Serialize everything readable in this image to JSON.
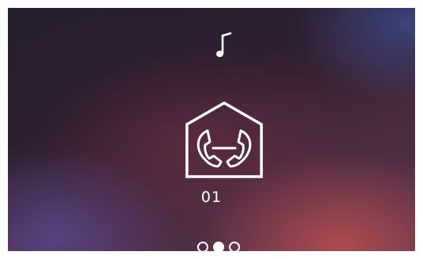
{
  "screen": {
    "channel_number": "01",
    "music_icon": "music-note-icon",
    "main_icon": "home-intercom-icon"
  },
  "pager": {
    "page_count": 3,
    "active_page": 2
  },
  "colors": {
    "foreground": "#ffffff",
    "frame": "#ffffff"
  }
}
